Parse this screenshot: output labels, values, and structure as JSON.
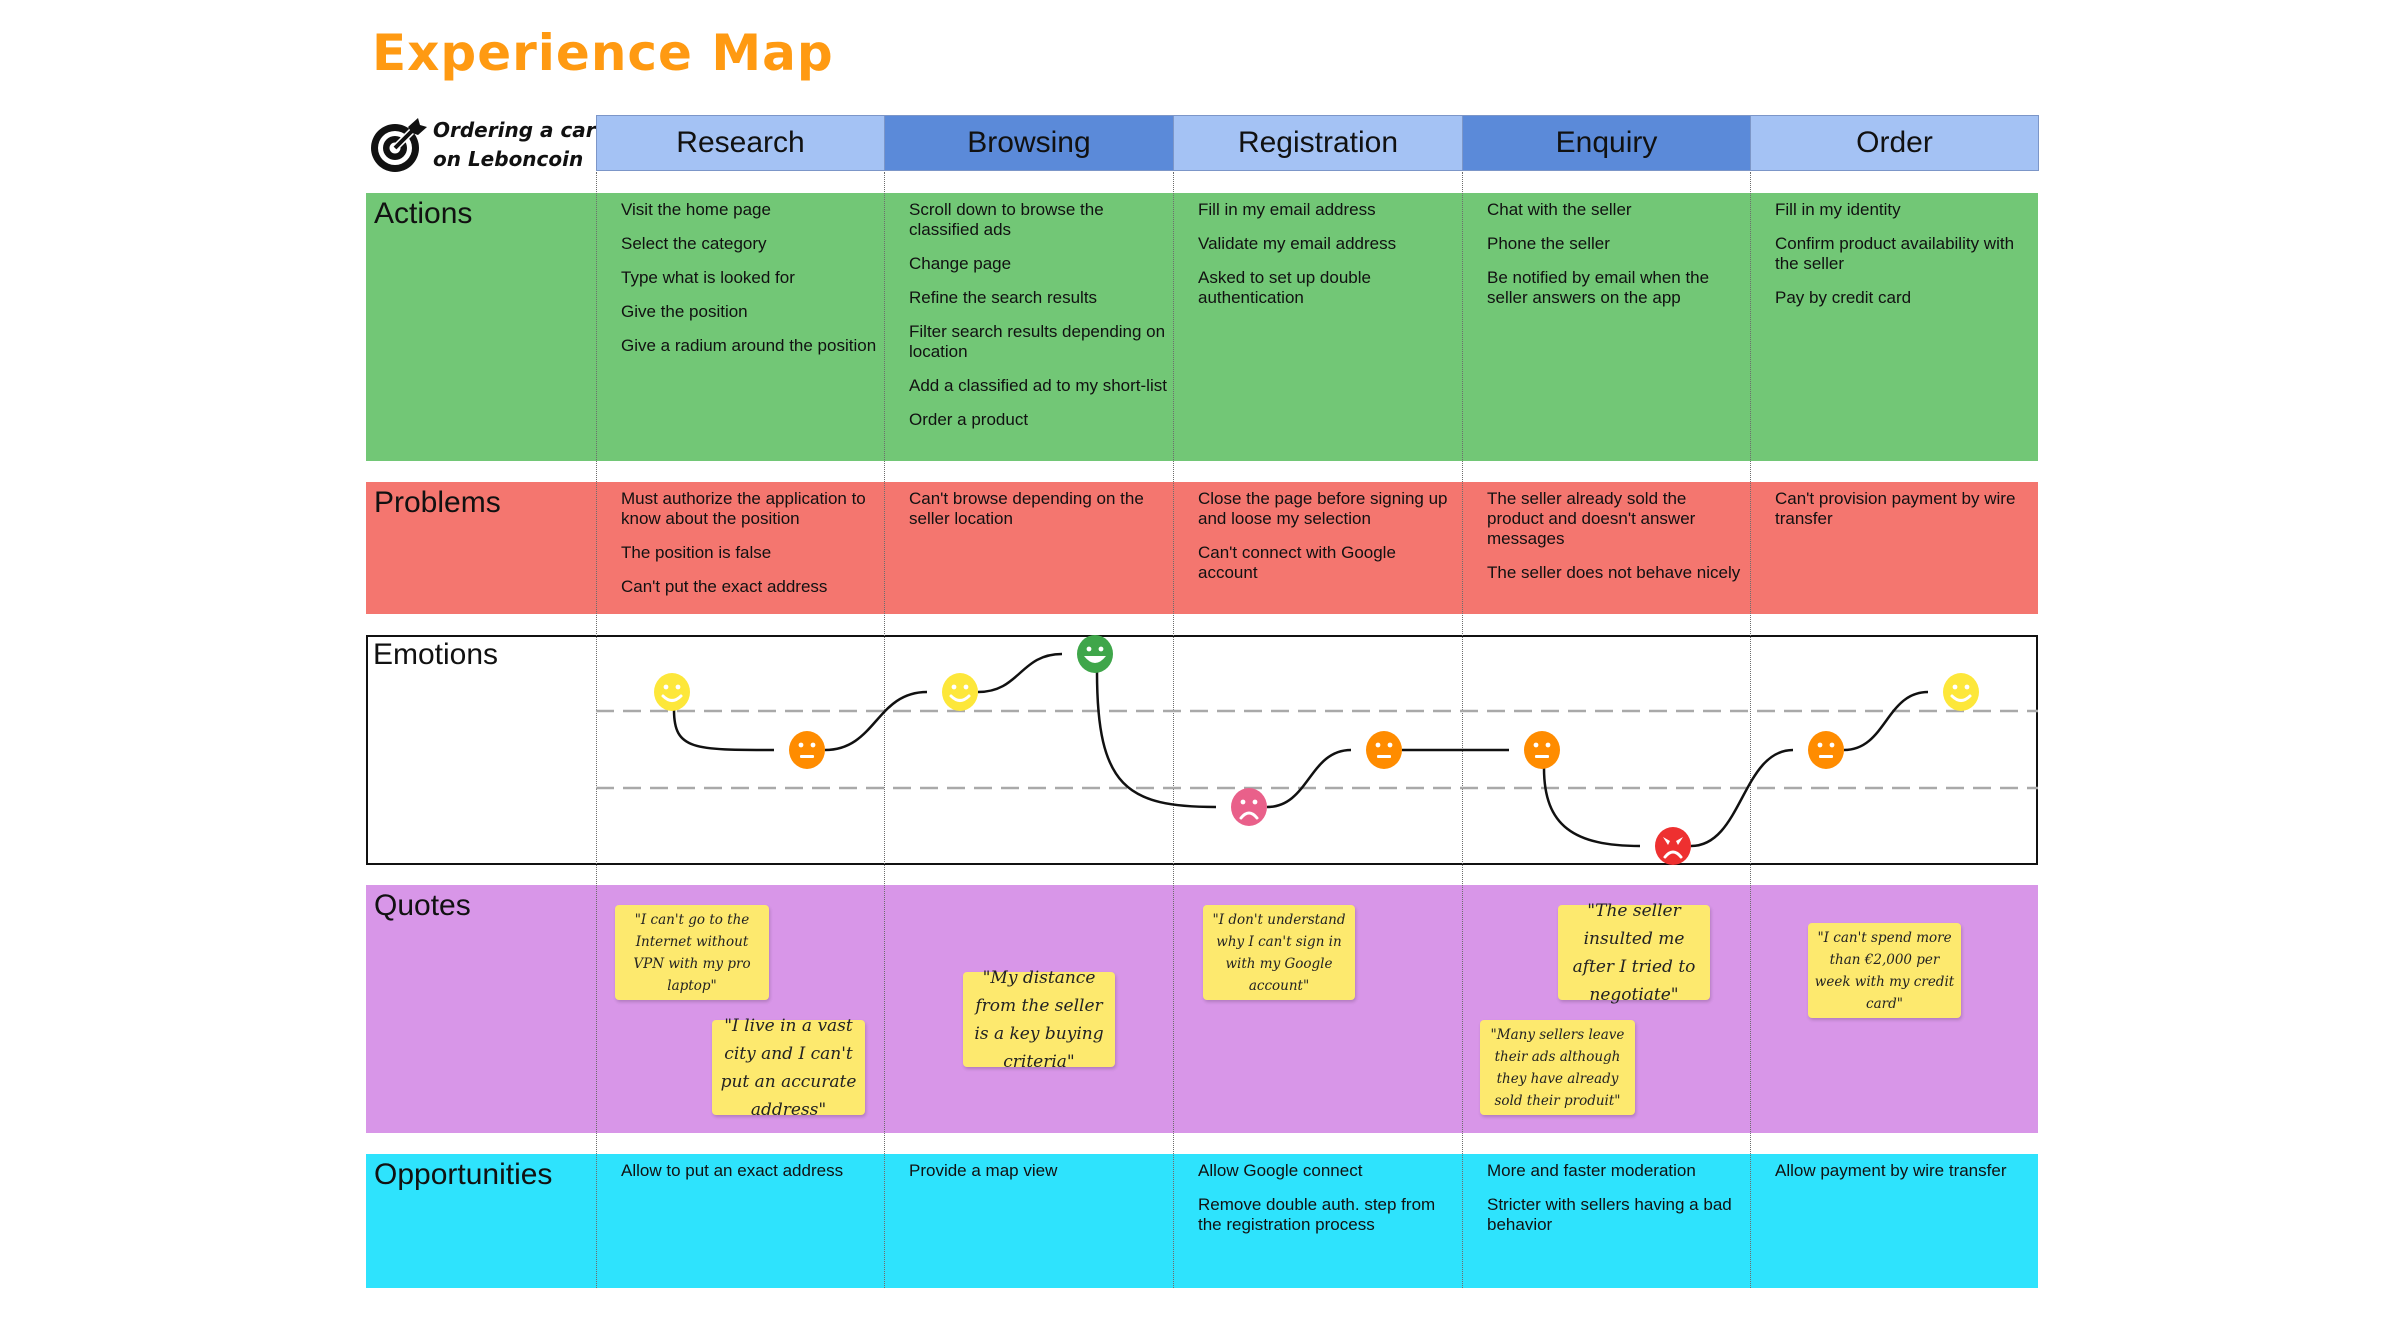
{
  "title": "Experience Map",
  "journey": {
    "line1": "Ordering a car",
    "line2": "on Leboncoin",
    "icon": "target-arrow-icon"
  },
  "phases": [
    {
      "label": "Research",
      "style": "light"
    },
    {
      "label": "Browsing",
      "style": "dark"
    },
    {
      "label": "Registration",
      "style": "light"
    },
    {
      "label": "Enquiry",
      "style": "dark"
    },
    {
      "label": "Order",
      "style": "light"
    }
  ],
  "colors": {
    "title": "#ff9a12",
    "phase_light": "#a4c2f4",
    "phase_dark": "#5b8ad9",
    "actions": "#72c776",
    "problems": "#f4766f",
    "quotes": "#d896e8",
    "opportunities": "#2ee3fd",
    "sticky": "#fde96e",
    "happy": "#fde73a",
    "very_happy": "#3fa64a",
    "neutral": "#ff8c00",
    "sad": "#e9608a",
    "angry": "#ee3030"
  },
  "lanes": {
    "actions": {
      "label": "Actions",
      "cells": [
        [
          "Visit the home page",
          "Select the category",
          "Type what is looked for",
          "Give the position",
          "Give a radium around the position"
        ],
        [
          "Scroll down to browse the classified ads",
          "Change page",
          "Refine the search results",
          "Filter search results depending on location",
          "Add a classified ad to my short-list",
          "Order a product"
        ],
        [
          "Fill in my email address",
          "Validate my email address",
          "Asked to set up double authentication"
        ],
        [
          "Chat with the seller",
          "Phone the seller",
          "Be notified by email when the seller answers on the app"
        ],
        [
          "Fill in my identity",
          "Confirm product availability with the seller",
          "Pay by credit card"
        ]
      ]
    },
    "problems": {
      "label": "Problems",
      "cells": [
        [
          "Must authorize the application to know about the position",
          "The position is false",
          "Can't put the exact address"
        ],
        [
          "Can't browse depending on the seller location"
        ],
        [
          "Close the page before signing up and loose my selection",
          "Can't connect with Google account"
        ],
        [
          "The seller already sold the product and doesn't answer messages",
          "The seller does not behave nicely"
        ],
        [
          "Can't provision payment by wire transfer"
        ]
      ]
    },
    "emotions": {
      "label": "Emotions",
      "levels": [
        "very_happy",
        "happy",
        "neutral",
        "sad",
        "angry"
      ],
      "points": [
        {
          "phase": "Research",
          "mood": "happy"
        },
        {
          "phase": "Research",
          "mood": "neutral"
        },
        {
          "phase": "Browsing",
          "mood": "happy"
        },
        {
          "phase": "Browsing",
          "mood": "very_happy"
        },
        {
          "phase": "Registration",
          "mood": "sad"
        },
        {
          "phase": "Registration",
          "mood": "neutral"
        },
        {
          "phase": "Enquiry",
          "mood": "neutral"
        },
        {
          "phase": "Enquiry",
          "mood": "angry"
        },
        {
          "phase": "Order",
          "mood": "neutral"
        },
        {
          "phase": "Order",
          "mood": "happy"
        }
      ]
    },
    "quotes": {
      "label": "Quotes",
      "notes": [
        {
          "phase": "Research",
          "text": "\"I can't go to the Internet without VPN with my pro laptop\""
        },
        {
          "phase": "Research",
          "text": "\"I live in a vast city and I can't put an accurate address\""
        },
        {
          "phase": "Browsing",
          "text": "\"My distance from the seller is a key buying criteria\""
        },
        {
          "phase": "Registration",
          "text": "\"I don't understand why I can't sign in with my Google account\""
        },
        {
          "phase": "Enquiry",
          "text": "\"The seller insulted me after I tried to negotiate\""
        },
        {
          "phase": "Enquiry",
          "text": "\"Many sellers leave their ads although they have already sold their produit\""
        },
        {
          "phase": "Order",
          "text": "\"I can't spend more than €2,000 per week with my credit card\""
        }
      ]
    },
    "opportunities": {
      "label": "Opportunities",
      "cells": [
        [
          "Allow to put an exact address"
        ],
        [
          "Provide a map view"
        ],
        [
          "Allow Google connect",
          "Remove double auth. step from the registration process"
        ],
        [
          "More and faster moderation",
          "Stricter with sellers having a bad behavior"
        ],
        [
          "Allow payment by wire transfer"
        ]
      ]
    }
  }
}
